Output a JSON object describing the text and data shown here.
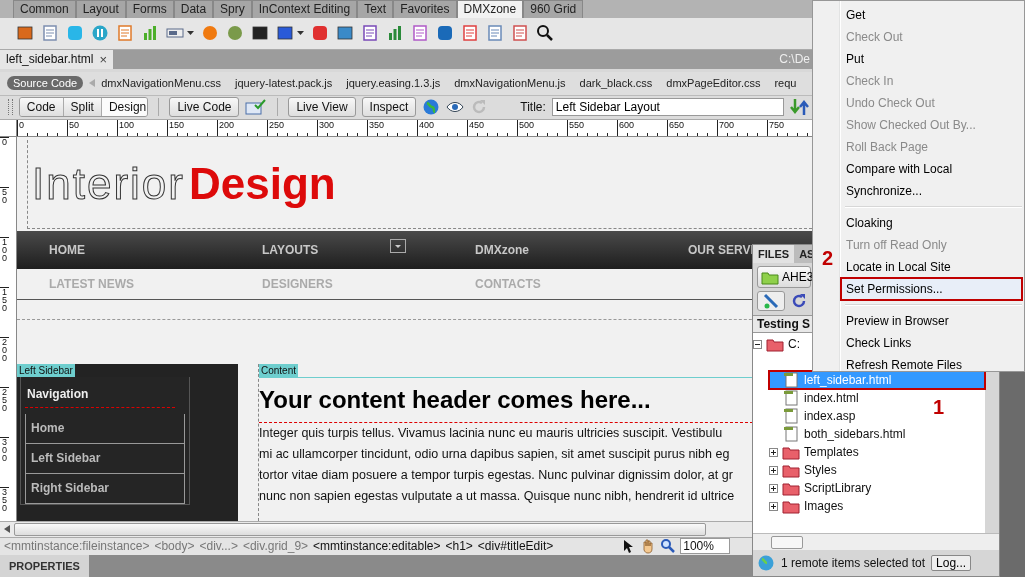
{
  "insert_bar": {
    "tabs": [
      {
        "label": "Common",
        "selected": false
      },
      {
        "label": "Layout",
        "selected": false
      },
      {
        "label": "Forms",
        "selected": false
      },
      {
        "label": "Data",
        "selected": false
      },
      {
        "label": "Spry",
        "selected": false
      },
      {
        "label": "InContext Editing",
        "selected": false
      },
      {
        "label": "Text",
        "selected": false
      },
      {
        "label": "Favorites",
        "selected": false
      },
      {
        "label": "DMXzone",
        "selected": true
      },
      {
        "label": "960 Grid",
        "selected": false
      }
    ]
  },
  "document_tab": {
    "label": "left_sidebar.html",
    "close": "×",
    "path": "C:\\De"
  },
  "related_files": {
    "items": [
      {
        "label": "Source Code",
        "selected": true
      },
      {
        "label": "dmxNavigationMenu.css",
        "selected": false
      },
      {
        "label": "jquery-latest.pack.js",
        "selected": false
      },
      {
        "label": "jquery.easing.1.3.js",
        "selected": false
      },
      {
        "label": "dmxNavigationMenu.js",
        "selected": false
      },
      {
        "label": "dark_black.css",
        "selected": false
      },
      {
        "label": "dmxPageEditor.css",
        "selected": false
      },
      {
        "label": "requ",
        "selected": false
      }
    ]
  },
  "document_toolbar": {
    "views": [
      {
        "label": "Code",
        "selected": false
      },
      {
        "label": "Split",
        "selected": false
      },
      {
        "label": "Design",
        "selected": true
      }
    ],
    "live_code": "Live Code",
    "live_view": "Live View",
    "inspect": "Inspect",
    "title_label": "Title:",
    "title_value": "Left Sidebar Layout"
  },
  "ruler": {
    "horizontal": [
      "0",
      "50",
      "100",
      "150",
      "200",
      "250",
      "300",
      "350",
      "400",
      "450",
      "500",
      "550",
      "600",
      "650",
      "700",
      "750"
    ],
    "vertical": [
      "0",
      "50",
      "100",
      "150",
      "200",
      "250",
      "300",
      "350"
    ]
  },
  "page": {
    "logo_light": "Interior",
    "logo_bold": "Design",
    "nav_primary": [
      "HOME",
      "LAYOUTS",
      "DMXzone",
      "OUR SERVI"
    ],
    "nav_secondary": [
      "LATEST NEWS",
      "DESIGNERS",
      "CONTACTS"
    ],
    "left_sidebar": {
      "label": "Left Sidebar",
      "heading": "Navigation",
      "items": [
        "Home",
        "Left Sidebar",
        "Right Sidebar"
      ]
    },
    "content": {
      "label": "Content",
      "heading": "Your content header comes here...",
      "lines": [
        "Integer quis turpis tellus. Vivamus lacinia nunc eu mauris ultricies suscipit. Vestibulu",
        "mi ac ullamcorper tincidunt, odio urna dapibus sapien, sit amet suscipit purus nibh eg",
        "tortor vitae diam posuere a tempor turpis egestas. Nunc pulvinar dignissim dolor, at gr",
        "nunc non sapien egestas vulputate a ut massa. Quisque nunc nibh, hendrerit id ultrice"
      ]
    }
  },
  "tag_selector": {
    "tags": [
      {
        "label": "<mmtinstance:fileinstance>",
        "disabled": true
      },
      {
        "label": "<body>",
        "disabled": true
      },
      {
        "label": "<div...>",
        "disabled": true
      },
      {
        "label": "<div.grid_9>",
        "disabled": true
      },
      {
        "label": "<mmtinstance:editable>",
        "disabled": false
      },
      {
        "label": "<h1>",
        "disabled": false
      },
      {
        "label": "<div#titleEdit>",
        "disabled": false
      }
    ],
    "zoom": "100%"
  },
  "properties_panel": {
    "title": "PROPERTIES"
  },
  "files_panel": {
    "tabs": [
      {
        "label": "FILES",
        "selected": true
      },
      {
        "label": "AS",
        "selected": false
      }
    ],
    "site": "AHE3",
    "column_header": "Testing S",
    "tree": [
      {
        "name": "C:",
        "kind": "folder",
        "expanded": true,
        "selected": false,
        "children": [
          {
            "name": "left_sidebar.html",
            "kind": "file",
            "selected": true
          },
          {
            "name": "index.html",
            "kind": "file",
            "selected": false
          },
          {
            "name": "index.asp",
            "kind": "file",
            "selected": false
          },
          {
            "name": "both_sidebars.html",
            "kind": "file",
            "selected": false
          },
          {
            "name": "Templates",
            "kind": "folder",
            "expanded": false,
            "selected": false
          },
          {
            "name": "Styles",
            "kind": "folder",
            "expanded": false,
            "selected": false
          },
          {
            "name": "ScriptLibrary",
            "kind": "folder",
            "expanded": false,
            "selected": false
          },
          {
            "name": "Images",
            "kind": "folder",
            "expanded": false,
            "selected": false
          }
        ]
      }
    ],
    "status": "1 remote items selected tot",
    "log_button": "Log..."
  },
  "context_menu": {
    "groups": [
      [
        {
          "label": "Get",
          "disabled": false,
          "selected": false
        },
        {
          "label": "Check Out",
          "disabled": true,
          "selected": false
        },
        {
          "label": "Put",
          "disabled": false,
          "selected": false
        },
        {
          "label": "Check In",
          "disabled": true,
          "selected": false
        },
        {
          "label": "Undo Check Out",
          "disabled": true,
          "selected": false
        },
        {
          "label": "Show Checked Out By...",
          "disabled": true,
          "selected": false
        },
        {
          "label": "Roll Back Page",
          "disabled": true,
          "selected": false
        },
        {
          "label": "Compare with Local",
          "disabled": false,
          "selected": false
        },
        {
          "label": "Synchronize...",
          "disabled": false,
          "selected": false
        }
      ],
      [
        {
          "label": "Cloaking",
          "disabled": false,
          "selected": false
        },
        {
          "label": "Turn off Read Only",
          "disabled": true,
          "selected": false
        },
        {
          "label": "Locate in Local Site",
          "disabled": false,
          "selected": false
        },
        {
          "label": "Set Permissions...",
          "disabled": false,
          "selected": true
        }
      ],
      [
        {
          "label": "Preview in Browser",
          "disabled": false,
          "selected": false
        },
        {
          "label": "Check Links",
          "disabled": false,
          "selected": false
        },
        {
          "label": "Refresh Remote Files",
          "disabled": false,
          "selected": false
        }
      ]
    ]
  },
  "annotations": [
    {
      "label": "2"
    },
    {
      "label": "1"
    }
  ]
}
